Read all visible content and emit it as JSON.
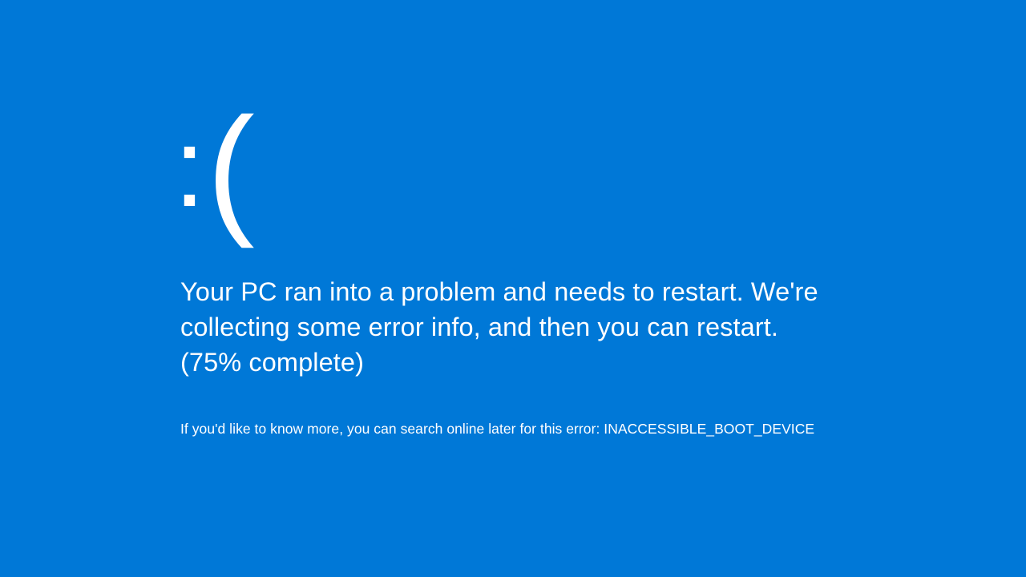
{
  "colors": {
    "background": "#0078d7",
    "foreground": "#ffffff"
  },
  "bsod": {
    "frown_face": ":(",
    "message": "Your PC ran into a problem and needs to restart. We're collecting some error info, and then you can restart. (75% complete)",
    "progress_percent": 75,
    "more_info_prefix": "If you'd like to know more, you can search online later for this error: ",
    "error_code": "INACCESSIBLE_BOOT_DEVICE"
  }
}
